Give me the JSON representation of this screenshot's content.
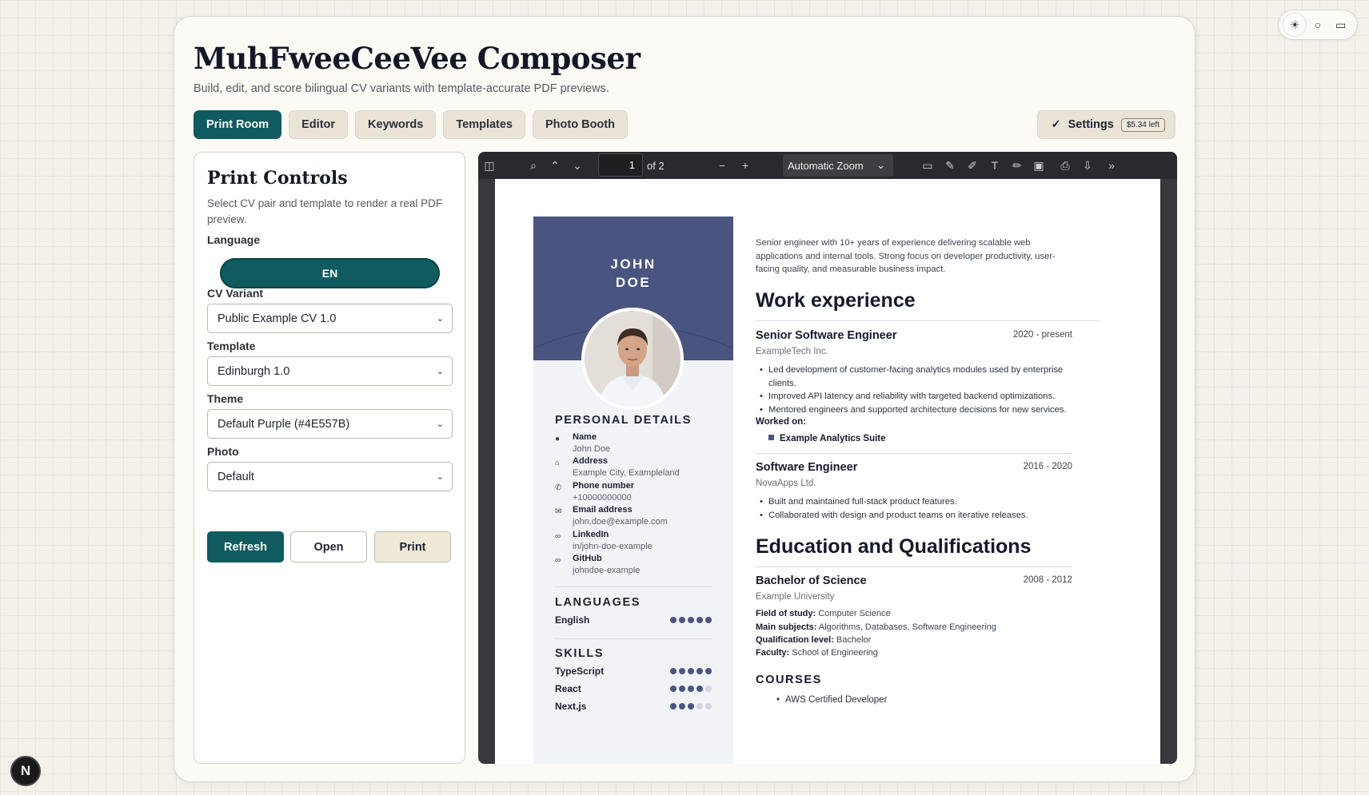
{
  "app": {
    "title": "MuhFweeCeeVee Composer",
    "subtitle": "Build, edit, and score bilingual CV variants with template-accurate PDF previews."
  },
  "theme_toggle": {
    "icons": [
      "sun-icon",
      "circle-icon",
      "monitor-icon"
    ]
  },
  "tabs": [
    {
      "label": "Print Room",
      "active": true
    },
    {
      "label": "Editor"
    },
    {
      "label": "Keywords"
    },
    {
      "label": "Templates"
    },
    {
      "label": "Photo Booth"
    }
  ],
  "settings": {
    "label": "Settings",
    "credit": "$5.34 left"
  },
  "controls": {
    "title": "Print Controls",
    "description": "Select CV pair and template to render a real PDF preview.",
    "language_label": "Language",
    "language_value": "EN",
    "variant_label": "CV Variant",
    "variant_value": "Public Example CV 1.0",
    "template_label": "Template",
    "template_value": "Edinburgh 1.0",
    "theme_label": "Theme",
    "theme_value": "Default Purple (#4E557B)",
    "photo_label": "Photo",
    "photo_value": "Default",
    "refresh": "Refresh",
    "open": "Open",
    "print": "Print"
  },
  "viewer": {
    "page": "1",
    "page_count": "of 2",
    "zoom": "Automatic Zoom"
  },
  "cv": {
    "name_first": "JOHN",
    "name_last": "DOE",
    "personal_title": "PERSONAL DETAILS",
    "personal": [
      {
        "label": "Name",
        "value": "John Doe",
        "icon": "person-icon"
      },
      {
        "label": "Address",
        "value": "Example City, Exampleland",
        "icon": "home-icon"
      },
      {
        "label": "Phone number",
        "value": "+10000000000",
        "icon": "phone-icon"
      },
      {
        "label": "Email address",
        "value": "john.doe@example.com",
        "icon": "mail-icon"
      },
      {
        "label": "LinkedIn",
        "value": "in/john-doe-example",
        "icon": "link-icon"
      },
      {
        "label": "GitHub",
        "value": "johndoe-example",
        "icon": "link-icon"
      }
    ],
    "languages_title": "LANGUAGES",
    "languages": [
      {
        "name": "English",
        "level": 5
      }
    ],
    "skills_title": "SKILLS",
    "skills": [
      {
        "name": "TypeScript",
        "level": 5
      },
      {
        "name": "React",
        "level": 4
      },
      {
        "name": "Next.js",
        "level": 3
      }
    ],
    "summary": "Senior engineer with 10+ years of experience delivering scalable web applications and internal tools. Strong focus on developer productivity, user-facing quality, and measurable business impact.",
    "work_title": "Work experience",
    "jobs": [
      {
        "title": "Senior Software Engineer",
        "date": "2020 - present",
        "org": "ExampleTech Inc.",
        "bullets": [
          "Led development of customer-facing analytics modules used by enterprise clients.",
          "Improved API latency and reliability with targeted backend optimizations.",
          "Mentored engineers and supported architecture decisions for new services."
        ],
        "worked_label": "Worked on:",
        "worked_item": "Example Analytics Suite"
      },
      {
        "title": "Software Engineer",
        "date": "2016 - 2020",
        "org": "NovaApps Ltd.",
        "bullets": [
          "Built and maintained full-stack product features.",
          "Collaborated with design and product teams on iterative releases."
        ]
      }
    ],
    "edu_title": "Education and Qualifications",
    "edu": {
      "title": "Bachelor of Science",
      "date": "2008 - 2012",
      "org": "Example University",
      "field_label": "Field of study:",
      "field": "Computer Science",
      "subjects_label": "Main subjects:",
      "subjects": "Algorithms, Databases, Software Engineering",
      "level_label": "Qualification level:",
      "level": "Bachelor",
      "faculty_label": "Faculty:",
      "faculty": "School of Engineering"
    },
    "courses_title": "COURSES",
    "courses": [
      "AWS Certified Developer"
    ]
  },
  "colors": {
    "accent": "#0f5b5f",
    "cv_theme": "#4E557B"
  }
}
